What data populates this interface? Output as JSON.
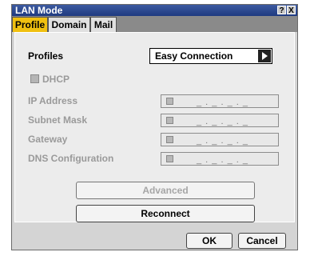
{
  "window": {
    "title": "LAN Mode",
    "help_glyph": "?",
    "close_glyph": "X"
  },
  "tabs": [
    {
      "label": "Profile",
      "active": true
    },
    {
      "label": "Domain",
      "active": false
    },
    {
      "label": "Mail",
      "active": false
    }
  ],
  "profile": {
    "profiles_label": "Profiles",
    "profiles_value": "Easy Connection",
    "dhcp_label": "DHCP",
    "fields": [
      {
        "label": "IP Address",
        "value": "_ . _ . _ . _"
      },
      {
        "label": "Subnet Mask",
        "value": "_ . _ . _ . _"
      },
      {
        "label": "Gateway",
        "value": "_ . _ . _ . _"
      },
      {
        "label": "DNS Configuration",
        "value": "_ . _ . _ . _"
      }
    ],
    "advanced_label": "Advanced",
    "reconnect_label": "Reconnect"
  },
  "footer": {
    "ok_label": "OK",
    "cancel_label": "Cancel"
  },
  "colors": {
    "title_bar": "#1f3a80",
    "active_tab": "#f0c010",
    "dialog_bg": "#d4d4d4"
  },
  "icons": [
    "help-icon",
    "close-icon",
    "dropdown-arrow-icon",
    "dhcp-checkbox"
  ]
}
